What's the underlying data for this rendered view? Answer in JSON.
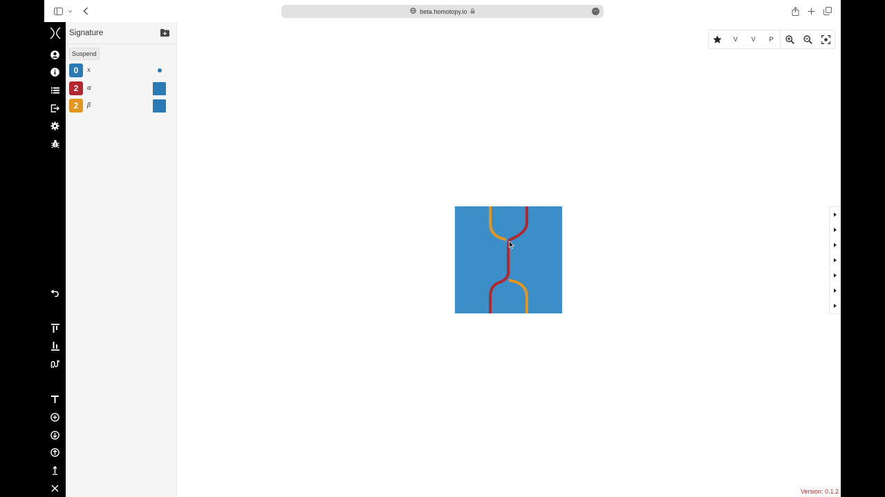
{
  "browser": {
    "url": "beta.homotopy.io"
  },
  "signature": {
    "title": "Signature",
    "suspend_label": "Suspend",
    "generators": [
      {
        "dimension": "0",
        "name": "x",
        "color": "#2a7ab5",
        "style": "dot"
      },
      {
        "dimension": "2",
        "name": "α",
        "color": "#b2282e",
        "style": "swatch"
      },
      {
        "dimension": "2",
        "name": "β",
        "color": "#e3961e",
        "style": "swatch"
      }
    ]
  },
  "toolbar": {
    "star_icon": "star-icon",
    "view_v1": "V",
    "view_v2": "V",
    "view_p": "P",
    "zoom_in_icon": "zoom-in-icon",
    "zoom_out_icon": "zoom-out-icon",
    "fit_icon": "fit-screen-icon"
  },
  "rail": {
    "top_icons": [
      "logo-icon",
      "user-icon",
      "info-icon",
      "list-icon",
      "export-icon",
      "gear-icon",
      "bug-icon"
    ],
    "bottom_icons": [
      "undo-icon",
      "restrict-icon",
      "theorem-icon",
      "homotopy-icon",
      "text-icon",
      "add-circle-icon",
      "down-circle-icon",
      "up-circle-icon",
      "identity-icon",
      "close-icon"
    ]
  },
  "colors": {
    "background_wire": "#3b8ec8",
    "alpha": "#b2282e",
    "beta": "#e3961e",
    "point": "#2a7ab5"
  },
  "version": "Version: 0.1.2"
}
